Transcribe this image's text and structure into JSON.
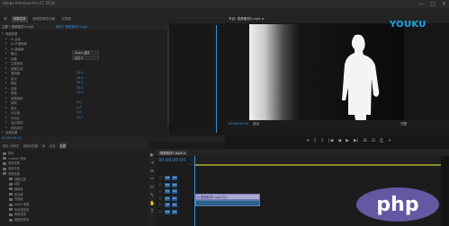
{
  "window": {
    "title": "Adobe Premiere Pro CC 2018",
    "controls": [
      "—",
      "□",
      "✕"
    ]
  },
  "source_panel": {
    "tabs": [
      "源",
      "效果控件",
      "音频剪辑混合器",
      "元数据"
    ],
    "clip_path_a": "主要 * 视频素材2.mp4",
    "clip_path_b": "序列 * 视频素材2.mp4",
    "properties": [
      {
        "label": "视频效果",
        "value": "",
        "kind": "header"
      },
      {
        "label": "fx 运动",
        "value": ""
      },
      {
        "label": "fx 不透明度",
        "value": ""
      },
      {
        "label": "fx 超级键",
        "value": ""
      },
      {
        "label": "输出",
        "value": "Alpha 通道",
        "kind": "select"
      },
      {
        "label": "设置",
        "value": "自定义",
        "kind": "select"
      },
      {
        "label": "主要颜色",
        "value": ""
      },
      {
        "label": "遮罩生成",
        "value": ""
      },
      {
        "label": "透明度",
        "value": "45.0"
      },
      {
        "label": "高光",
        "value": "10.0"
      },
      {
        "label": "阴影",
        "value": "50.0"
      },
      {
        "label": "容差",
        "value": "50.0"
      },
      {
        "label": "基值",
        "value": "10.0"
      },
      {
        "label": "遮罩清除",
        "value": ""
      },
      {
        "label": "抑制",
        "value": "0.0"
      },
      {
        "label": "柔化",
        "value": "0.0"
      },
      {
        "label": "对比度",
        "value": "0.0"
      },
      {
        "label": "中间点",
        "value": "50.0"
      },
      {
        "label": "溢出抑制",
        "value": ""
      },
      {
        "label": "颜色校正",
        "value": ""
      },
      {
        "label": "音频效果",
        "value": "",
        "kind": "header"
      }
    ],
    "timecode": "00:00:00:00"
  },
  "program_monitor": {
    "tab": "节目: 视频素材2.mp4 ≡",
    "timecode": "00:00:00:00",
    "fit": "适合",
    "full": "完整",
    "transport": [
      "▾",
      "{",
      "}",
      "|◀",
      "◀",
      "▶",
      "▶|",
      "⊞",
      "⊟",
      "⎙",
      "+"
    ]
  },
  "watermark_logo": "YOUKU",
  "project_panel": {
    "tabs": [
      "项目: 未命名",
      "媒体浏览器",
      "库",
      "信息",
      "效果"
    ],
    "items": [
      "预设",
      "Lumetri 预设",
      "音频效果",
      "音频过渡",
      "视频效果",
      "视频过渡",
      "键控",
      "超级键",
      "颜色键",
      "亮度键",
      "Alpha 调整",
      "轨道遮罩键",
      "差值遮罩",
      "图像遮罩键"
    ]
  },
  "tools": [
    "▶",
    "⇥",
    "⇹",
    "✂",
    "↔",
    "✎",
    "✋",
    "T"
  ],
  "timeline": {
    "tab": "视频素材2.mp4 ≡",
    "timecode": "00:00:00:00",
    "tracks": [
      "V3",
      "V2",
      "V1",
      "A1",
      "A2",
      "A3"
    ],
    "clip_video_label": "fx 视频素材2.mp4 [V]",
    "clip_audio_label": ""
  },
  "site_watermark": "php",
  "colors": {
    "accent": "#3a8fd9",
    "youku": "#1aa6e8",
    "php_bg": "#6b5fb0",
    "clip_video": "#a8a8d6",
    "clip_audio": "#2e5e8a"
  }
}
